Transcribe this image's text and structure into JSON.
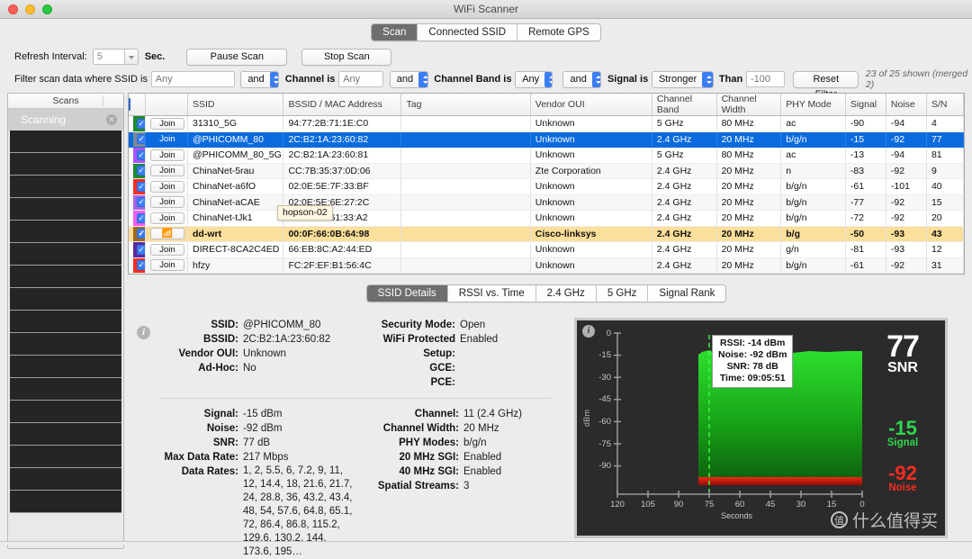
{
  "window": {
    "title": "WiFi Scanner"
  },
  "top_tabs": [
    {
      "label": "Scan",
      "active": true
    },
    {
      "label": "Connected SSID",
      "active": false
    },
    {
      "label": "Remote GPS",
      "active": false
    }
  ],
  "toolbar": {
    "refresh_label": "Refresh Interval:",
    "refresh_value": "5",
    "sec_label": "Sec.",
    "pause_label": "Pause Scan",
    "stop_label": "Stop Scan",
    "filter_prefix": "Filter scan data where SSID is",
    "ssid_placeholder": "Any",
    "and1": "and",
    "channel_label": "Channel is",
    "channel_placeholder": "Any",
    "and2": "and",
    "band_label": "Channel Band is",
    "band_value": "Any",
    "and3": "and",
    "signal_label": "Signal is",
    "signal_value": "Stronger",
    "than_label": "Than",
    "than_placeholder": "-100",
    "reset_label": "Reset Filter",
    "shown_count": "23 of 25 shown (merged 2)"
  },
  "sidebar": {
    "header": "Scans",
    "scanning_label": "Scanning",
    "stop_icon": "close-icon",
    "empty_rows": 17
  },
  "table": {
    "columns": [
      "",
      "",
      "SSID",
      "BSSID / MAC Address",
      "Tag",
      "Vendor OUI",
      "Channel Band",
      "Channel Width",
      "PHY Mode",
      "Signal",
      "Noise",
      "S/N"
    ],
    "join_label": "Join",
    "wifi_icon": "wifi-icon",
    "rows": [
      {
        "color": "#1c8b2e",
        "join": "Join",
        "ssid": "31310_5G",
        "bssid": "94:77:2B:71:1E:C0",
        "tag": "",
        "vendor": "Unknown",
        "band": "5 GHz",
        "width": "80 MHz",
        "phy": "ac",
        "signal": "-90",
        "noise": "-94",
        "sn": "4",
        "state": "normal"
      },
      {
        "color": "#7b8a93",
        "join": "Join",
        "ssid": "@PHICOMM_80",
        "bssid": "2C:B2:1A:23:60:82",
        "tag": "",
        "vendor": "Unknown",
        "band": "2.4 GHz",
        "width": "20 MHz",
        "phy": "b/g/n",
        "signal": "-15",
        "noise": "-92",
        "sn": "77",
        "state": "selected"
      },
      {
        "color": "#a855f7",
        "join": "Join",
        "ssid": "@PHICOMM_80_5G",
        "bssid": "2C:B2:1A:23:60:81",
        "tag": "",
        "vendor": "Unknown",
        "band": "5 GHz",
        "width": "80 MHz",
        "phy": "ac",
        "signal": "-13",
        "noise": "-94",
        "sn": "81",
        "state": "normal"
      },
      {
        "color": "#1c8b2e",
        "join": "Join",
        "ssid": "ChinaNet-5rau",
        "bssid": "CC:7B:35:37:0D:06",
        "tag": "",
        "vendor": "Zte Corporation",
        "band": "2.4 GHz",
        "width": "20 MHz",
        "phy": "n",
        "signal": "-83",
        "noise": "-92",
        "sn": "9",
        "state": "alt"
      },
      {
        "color": "#f42c21",
        "join": "Join",
        "ssid": "ChinaNet-a6fO",
        "bssid": "02:0E:5E:7F:33:BF",
        "tag": "",
        "vendor": "Unknown",
        "band": "2.4 GHz",
        "width": "20 MHz",
        "phy": "b/g/n",
        "signal": "-61",
        "noise": "-101",
        "sn": "40",
        "state": "normal"
      },
      {
        "color": "#a463e8",
        "join": "Join",
        "ssid": "ChinaNet-aCAE",
        "bssid": "02:0E:5E:6E:27:2C",
        "tag": "",
        "vendor": "Unknown",
        "band": "2.4 GHz",
        "width": "20 MHz",
        "phy": "b/g/n",
        "signal": "-77",
        "noise": "-92",
        "sn": "15",
        "state": "alt"
      },
      {
        "color": "#f45cf0",
        "join": "Join",
        "ssid": "ChinaNet-tJk1",
        "bssid": "02:0E:5E:61:33:A2",
        "tag": "",
        "vendor": "Unknown",
        "band": "2.4 GHz",
        "width": "20 MHz",
        "phy": "b/g/n",
        "signal": "-72",
        "noise": "-92",
        "sn": "20",
        "state": "normal"
      },
      {
        "color": "#a06a14",
        "join": "wifi",
        "ssid": "dd-wrt",
        "bssid": "00:0F:66:0B:64:98",
        "tag": "",
        "vendor": "Cisco-linksys",
        "band": "2.4 GHz",
        "width": "20 MHz",
        "phy": "b/g",
        "signal": "-50",
        "noise": "-93",
        "sn": "43",
        "state": "highlight"
      },
      {
        "color": "#5b2a9e",
        "join": "Join",
        "ssid": "DIRECT-8CA2C4ED",
        "bssid": "66:EB:8C:A2:44:ED",
        "tag": "",
        "vendor": "Unknown",
        "band": "2.4 GHz",
        "width": "20 MHz",
        "phy": "g/n",
        "signal": "-81",
        "noise": "-93",
        "sn": "12",
        "state": "normal"
      },
      {
        "color": "#f42c21",
        "join": "Join",
        "ssid": "hfzy",
        "bssid": "FC:2F:EF:B1:56:4C",
        "tag": "",
        "vendor": "Unknown",
        "band": "2.4 GHz",
        "width": "20 MHz",
        "phy": "b/g/n",
        "signal": "-61",
        "noise": "-92",
        "sn": "31",
        "state": "alt"
      }
    ],
    "tooltip": "hopson-02"
  },
  "detail_tabs": [
    {
      "label": "SSID Details",
      "active": true
    },
    {
      "label": "RSSI vs. Time",
      "active": false
    },
    {
      "label": "2.4 GHz",
      "active": false
    },
    {
      "label": "5 GHz",
      "active": false
    },
    {
      "label": "Signal Rank",
      "active": false
    }
  ],
  "details": {
    "top_left": [
      {
        "key": "SSID:",
        "value": "@PHICOMM_80"
      },
      {
        "key": "BSSID:",
        "value": "2C:B2:1A:23:60:82"
      },
      {
        "key": "Vendor OUI:",
        "value": "Unknown"
      },
      {
        "key": "Ad-Hoc:",
        "value": "No"
      }
    ],
    "top_right": [
      {
        "key": "Security Mode:",
        "value": "Open"
      },
      {
        "key": "WiFi Protected Setup:",
        "value": "Enabled"
      },
      {
        "key": "GCE:",
        "value": ""
      },
      {
        "key": "PCE:",
        "value": ""
      }
    ],
    "bottom_left": [
      {
        "key": "Signal:",
        "value": "-15 dBm"
      },
      {
        "key": "Noise:",
        "value": "-92 dBm"
      },
      {
        "key": "SNR:",
        "value": "77 dB"
      },
      {
        "key": "Max Data Rate:",
        "value": "217 Mbps"
      },
      {
        "key": "Data Rates:",
        "value": "1, 2, 5.5, 6, 7.2, 9, 11, 12, 14.4, 18, 21.6, 21.7, 24, 28.8, 36, 43.2, 43.4, 48, 54, 57.6, 64.8, 65.1, 72, 86.4, 86.8, 115.2, 129.6, 130.2, 144, 173.6, 195…",
        "wrap": true
      }
    ],
    "bottom_right": [
      {
        "key": "Channel:",
        "value": "11 (2.4 GHz)"
      },
      {
        "key": "Channel Width:",
        "value": "20 MHz"
      },
      {
        "key": "PHY Modes:",
        "value": "b/g/n"
      },
      {
        "key": "20 MHz SGI:",
        "value": "Enabled"
      },
      {
        "key": "40 MHz SGI:",
        "value": "Enabled"
      },
      {
        "key": "Spatial Streams:",
        "value": "3"
      }
    ]
  },
  "chart_data": {
    "type": "area",
    "title": "",
    "xlabel": "Seconds",
    "ylabel": "dBm",
    "ylim": [
      -100,
      0
    ],
    "xlim": [
      120,
      0
    ],
    "y_ticks": [
      "0",
      "-15",
      "-30",
      "-45",
      "-60",
      "-75",
      "-90"
    ],
    "x_ticks": [
      "120",
      "105",
      "90",
      "75",
      "60",
      "45",
      "30",
      "15",
      "0"
    ],
    "grid": false,
    "legend": "none",
    "series": [
      {
        "name": "Signal",
        "color": "#22c924",
        "x": [
          80,
          75,
          70,
          65,
          60,
          55,
          50,
          45,
          40,
          35,
          30,
          25,
          20,
          15,
          10,
          5,
          0
        ],
        "values": [
          -16,
          -14,
          -15,
          -16,
          -16,
          -16,
          -16,
          -16,
          -17,
          -17,
          -16,
          -15,
          -15,
          -16,
          -16,
          -15,
          -15
        ]
      },
      {
        "name": "Noise",
        "color": "#cf1008",
        "x": [
          80,
          75,
          70,
          65,
          60,
          55,
          50,
          45,
          40,
          35,
          30,
          25,
          20,
          15,
          10,
          5,
          0
        ],
        "values": [
          -92,
          -92,
          -92,
          -92,
          -92,
          -92,
          -92,
          -92,
          -92,
          -92,
          -92,
          -92,
          -92,
          -92,
          -92,
          -92,
          -92
        ]
      }
    ],
    "cursor": {
      "x": 75,
      "dashed": true
    },
    "tooltip_lines": [
      "RSSI: -14 dBm",
      "Noise: -92 dBm",
      "SNR: 78 dB",
      "Time: 09:05:51"
    ],
    "readouts": {
      "snr_value": "77",
      "snr_label": "SNR",
      "signal_value": "-15",
      "signal_label": "Signal",
      "noise_value": "-92",
      "noise_label": "Noise"
    },
    "info_icon": "info-icon"
  },
  "watermark": {
    "glyph": "值",
    "text": "什么值得买"
  }
}
